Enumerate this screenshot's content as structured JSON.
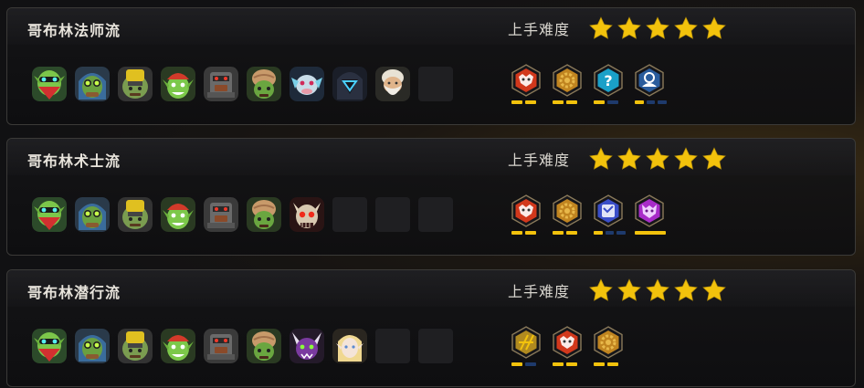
{
  "difficulty_label": "上手难度",
  "accent_color": "#f2c20c",
  "comps": [
    {
      "title": "哥布林法师流",
      "stars": 5,
      "heroes": [
        "goblin-bandana",
        "goblin-goggles-hood",
        "goblin-helmet",
        "goblin-red-cap",
        "goblin-mech",
        "goblin-turban",
        "ice-dragon",
        "hooded-mask",
        "sage-elder",
        "empty"
      ],
      "traits": [
        {
          "icon": "goblin-trait-icon",
          "color": "#d2381c",
          "bars": [
            1,
            1
          ]
        },
        {
          "icon": "gear-trait-icon",
          "color": "#c08420",
          "bars": [
            1,
            1
          ]
        },
        {
          "icon": "mystic-trait-icon",
          "color": "#1aa0c8",
          "bars": [
            1,
            0
          ]
        },
        {
          "icon": "mage-trait-icon",
          "color": "#2a5c9c",
          "bars": [
            1,
            0,
            0
          ]
        }
      ]
    },
    {
      "title": "哥布林术士流",
      "stars": 5,
      "heroes": [
        "goblin-bandana",
        "goblin-goggles-hood",
        "goblin-helmet",
        "goblin-red-cap",
        "goblin-mech",
        "goblin-turban",
        "horned-skull",
        "empty",
        "empty",
        "empty"
      ],
      "traits": [
        {
          "icon": "goblin-trait-icon",
          "color": "#d2381c",
          "bars": [
            1,
            1
          ]
        },
        {
          "icon": "gear-trait-icon",
          "color": "#c08420",
          "bars": [
            1,
            1
          ]
        },
        {
          "icon": "warlock-trait-icon",
          "color": "#3a4ec8",
          "bars": [
            1,
            0,
            0
          ]
        },
        {
          "icon": "demon-trait-icon",
          "color": "#a82cc8",
          "bars": [
            "long"
          ]
        }
      ]
    },
    {
      "title": "哥布林潜行流",
      "stars": 5,
      "heroes": [
        "goblin-bandana",
        "goblin-goggles-hood",
        "goblin-helmet",
        "goblin-red-cap",
        "goblin-mech",
        "goblin-turban",
        "purple-beast",
        "blonde-elf",
        "empty",
        "empty"
      ],
      "traits": [
        {
          "icon": "assassin-trait-icon",
          "color": "#b08a20",
          "bars": [
            1,
            0
          ]
        },
        {
          "icon": "goblin-trait-icon",
          "color": "#d2381c",
          "bars": [
            1,
            1
          ]
        },
        {
          "icon": "gear-trait-icon",
          "color": "#c08420",
          "bars": [
            1,
            1
          ]
        }
      ]
    }
  ]
}
